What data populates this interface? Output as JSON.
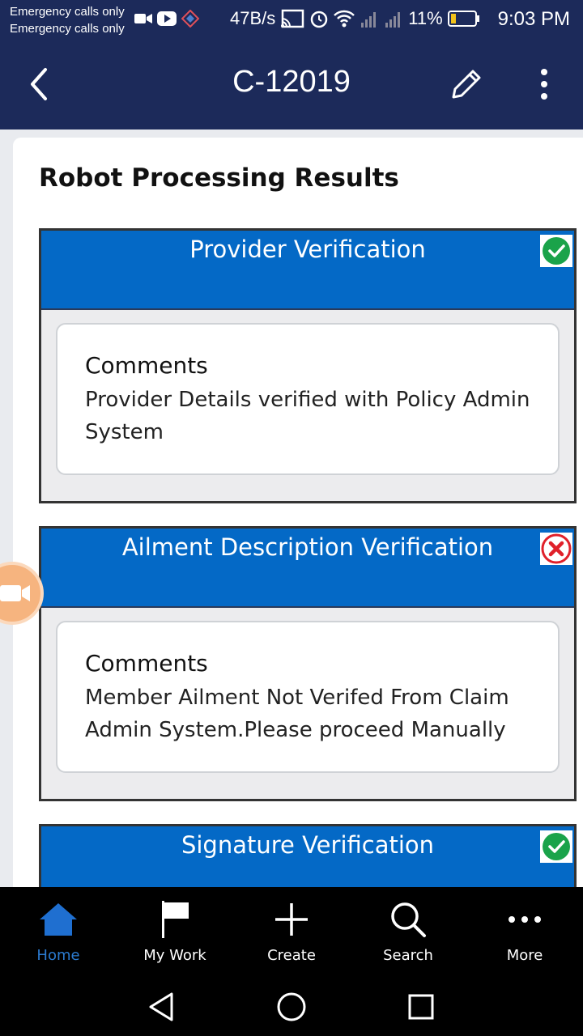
{
  "status_bar": {
    "carrier_line_1": "Emergency calls only",
    "carrier_line_2": "Emergency calls only",
    "net_speed": "47B/s",
    "battery": "11%",
    "time": "9:03 PM"
  },
  "app_bar": {
    "title": "C-12019"
  },
  "content": {
    "section_title": "Robot Processing Results",
    "results": [
      {
        "title": "Provider Verification",
        "status": "passed",
        "comment_label": "Comments",
        "comment_text": "Provider Details verified with Policy Admin System"
      },
      {
        "title": "Ailment Description Verification",
        "status": "failed",
        "comment_label": "Comments",
        "comment_text": "Member Ailment Not Verifed From Claim Admin System.Please proceed Manually"
      },
      {
        "title": "Signature Verification",
        "status": "passed"
      }
    ]
  },
  "bottom_nav": {
    "items": [
      {
        "label": "Home",
        "icon": "home-icon",
        "active": true
      },
      {
        "label": "My Work",
        "icon": "flag-icon",
        "active": false
      },
      {
        "label": "Create",
        "icon": "plus-icon",
        "active": false
      },
      {
        "label": "Search",
        "icon": "search-icon",
        "active": false
      },
      {
        "label": "More",
        "icon": "more-icon",
        "active": false
      }
    ]
  },
  "colors": {
    "app_bar": "#1c2a5a",
    "result_header": "#0469c6",
    "pass": "#1aa34a",
    "fail": "#e0202a",
    "nav_active": "#2b7bd0"
  }
}
